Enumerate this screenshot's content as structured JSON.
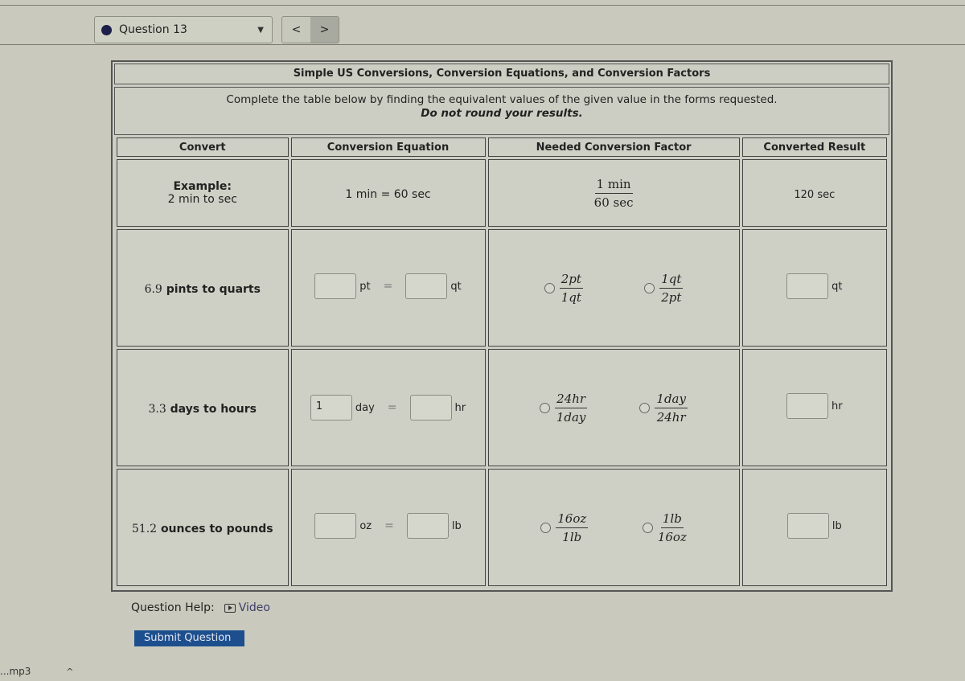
{
  "topbar": {
    "question_select": "Question 13",
    "prev_label": "<",
    "next_label": ">"
  },
  "problem": {
    "title": "Simple US Conversions, Conversion Equations, and Conversion Factors",
    "instruction": "Complete the table below by finding the equivalent values of the given value in the forms requested.",
    "instruction_emphasis": "Do not round your results."
  },
  "table": {
    "headers": [
      "Convert",
      "Conversion Equation",
      "Needed Conversion Factor",
      "Converted Result"
    ],
    "example": {
      "label": "Example:",
      "text": "2 min to sec",
      "equation": "1 min = 60 sec",
      "factor_num": "1 min",
      "factor_den": "60 sec",
      "result": "120 sec"
    },
    "rows": [
      {
        "value": "6.9",
        "text": "pints to quarts",
        "eq_left_value": "",
        "eq_left_unit": "pt",
        "eq_equals": "=",
        "eq_right_value": "",
        "eq_right_unit": "qt",
        "options": [
          {
            "num": "2pt",
            "den": "1qt"
          },
          {
            "num": "1qt",
            "den": "2pt"
          }
        ],
        "result_value": "",
        "result_unit": "qt"
      },
      {
        "value": "3.3",
        "text": "days to hours",
        "eq_left_value": "1",
        "eq_left_unit": "day",
        "eq_equals": "=",
        "eq_right_value": "",
        "eq_right_unit": "hr",
        "options": [
          {
            "num": "24hr",
            "den": "1day"
          },
          {
            "num": "1day",
            "den": "24hr"
          }
        ],
        "result_value": "",
        "result_unit": "hr"
      },
      {
        "value": "51.2",
        "text": "ounces to pounds",
        "eq_left_value": "",
        "eq_left_unit": "oz",
        "eq_equals": "=",
        "eq_right_value": "",
        "eq_right_unit": "lb",
        "options": [
          {
            "num": "16oz",
            "den": "1lb"
          },
          {
            "num": "1lb",
            "den": "16oz"
          }
        ],
        "result_value": "",
        "result_unit": "lb"
      }
    ]
  },
  "help": {
    "label": "Question Help:",
    "video_label": "Video"
  },
  "submit_label": "Submit Question",
  "download_bar": {
    "file_label": "...mp3",
    "chevron": "^"
  }
}
